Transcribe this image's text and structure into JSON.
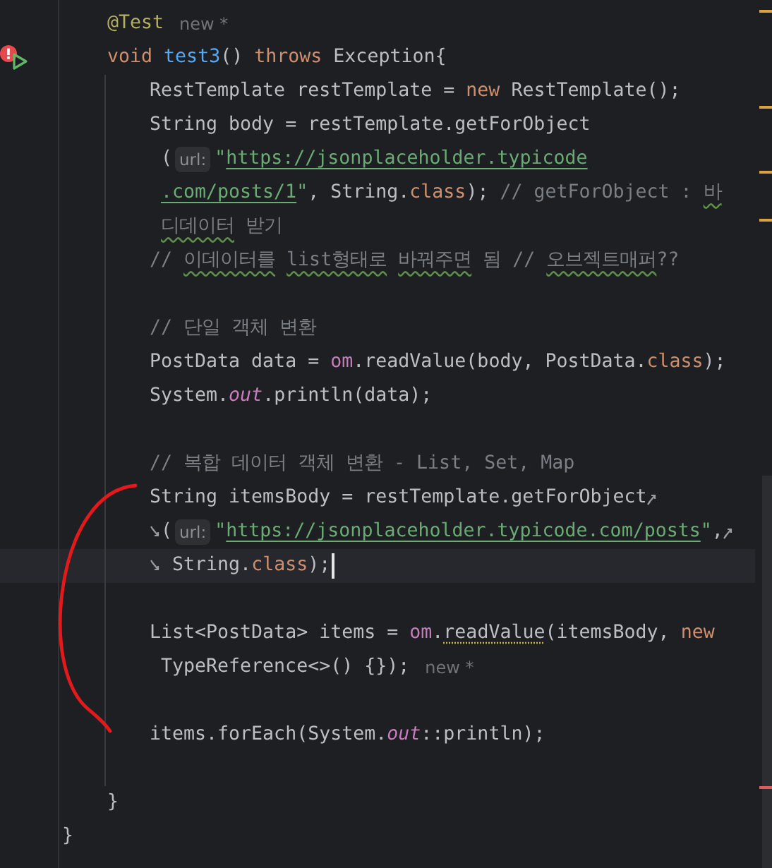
{
  "method": {
    "header": [
      {
        "tokens": [
          {
            "kind": "annotation",
            "text": "@Test"
          },
          {
            "kind": "hint",
            "text": "new *"
          }
        ]
      },
      {
        "error": true,
        "runnable": true,
        "tokens": [
          {
            "kind": "kw",
            "text": "void "
          },
          {
            "kind": "fn",
            "text": "test3"
          },
          {
            "kind": "plain",
            "text": "() "
          },
          {
            "kind": "kw",
            "text": "throws"
          },
          {
            "kind": "plain",
            "text": " Exception{"
          }
        ]
      }
    ],
    "body": [
      {
        "tokens": [
          {
            "kind": "plain",
            "text": "RestTemplate restTemplate = "
          },
          {
            "kind": "kw",
            "text": "new"
          },
          {
            "kind": "plain",
            "text": " RestTemplate();"
          }
        ]
      },
      {
        "tokens": [
          {
            "kind": "plain",
            "text": "String body = restTemplate.getForObject"
          }
        ]
      },
      {
        "continuation": true,
        "tokens": [
          {
            "kind": "plain",
            "text": "("
          },
          {
            "kind": "inlay",
            "text": "url:"
          },
          {
            "kind": "str",
            "text": "\""
          },
          {
            "kind": "url",
            "text": "https://jsonplaceholder.typicode"
          }
        ]
      },
      {
        "continuation": true,
        "tokens": [
          {
            "kind": "url",
            "text": ".com/posts/1"
          },
          {
            "kind": "str",
            "text": "\""
          },
          {
            "kind": "plain",
            "text": ", String."
          },
          {
            "kind": "kw",
            "text": "class"
          },
          {
            "kind": "plain",
            "text": "); "
          },
          {
            "kind": "comment",
            "text": "// getForObject : "
          },
          {
            "kind": "comment",
            "text": "바",
            "typo": true
          }
        ]
      },
      {
        "continuation": true,
        "tokens": [
          {
            "kind": "comment",
            "text": "디데이터",
            "typo": true
          },
          {
            "kind": "comment",
            "text": " 받기"
          }
        ]
      },
      {
        "tokens": [
          {
            "kind": "comment",
            "text": "// "
          },
          {
            "kind": "comment",
            "text": "이데이터를 ",
            "typo": true
          },
          {
            "kind": "comment",
            "text": "list형태로 ",
            "typo": true
          },
          {
            "kind": "comment",
            "text": "바꿔주면",
            "typo": true
          },
          {
            "kind": "comment",
            "text": " 됨 // "
          },
          {
            "kind": "comment",
            "text": "오브젝트매퍼",
            "typo": true
          },
          {
            "kind": "comment",
            "text": "??"
          }
        ]
      },
      {
        "blank_line_before": true,
        "tokens": [
          {
            "kind": "comment",
            "text": "// 단일 객체 변환"
          }
        ]
      },
      {
        "tokens": [
          {
            "kind": "plain",
            "text": "PostData data = "
          },
          {
            "kind": "field",
            "text": "om"
          },
          {
            "kind": "plain",
            "text": ".readValue(body, PostData."
          },
          {
            "kind": "kw",
            "text": "class"
          },
          {
            "kind": "plain",
            "text": ");"
          }
        ]
      },
      {
        "tokens": [
          {
            "kind": "plain",
            "text": "System."
          },
          {
            "kind": "static",
            "text": "out"
          },
          {
            "kind": "plain",
            "text": ".println(data);"
          }
        ]
      },
      {
        "blank_line_before": true,
        "tokens": [
          {
            "kind": "comment",
            "text": "// 복합 데이터 객체 변환 - List, Set, Map"
          }
        ]
      },
      {
        "tokens": [
          {
            "kind": "plain",
            "text": "String itemsBody = restTemplate.getForObject"
          },
          {
            "kind": "wrap-end"
          }
        ]
      },
      {
        "tokens": [
          {
            "kind": "wrap-start"
          },
          {
            "kind": "plain",
            "text": "("
          },
          {
            "kind": "inlay",
            "text": "url:"
          },
          {
            "kind": "str",
            "text": "\""
          },
          {
            "kind": "url",
            "text": "https://jsonplaceholder.typicode.com/posts"
          },
          {
            "kind": "str",
            "text": "\""
          },
          {
            "kind": "plain",
            "text": ","
          },
          {
            "kind": "wrap-end"
          }
        ]
      },
      {
        "current": true,
        "tokens": [
          {
            "kind": "wrap-start"
          },
          {
            "kind": "plain",
            "text": " String."
          },
          {
            "kind": "kw",
            "text": "class"
          },
          {
            "kind": "plain",
            "text": ");"
          }
        ]
      },
      {
        "blank_line_before": true,
        "tokens": [
          {
            "kind": "plain",
            "text": "List<PostData> items = "
          },
          {
            "kind": "field",
            "text": "om"
          },
          {
            "kind": "plain",
            "text": "."
          },
          {
            "kind": "plain",
            "text": "readValue",
            "weak": true
          },
          {
            "kind": "plain",
            "text": "(itemsBody, "
          },
          {
            "kind": "kw",
            "text": "new"
          }
        ]
      },
      {
        "continuation": true,
        "tokens": [
          {
            "kind": "plain",
            "text": "TypeReference<>() {});"
          },
          {
            "kind": "hint",
            "text": "new *"
          }
        ]
      },
      {
        "blank_line_before": true,
        "blank_line_after": true,
        "tokens": [
          {
            "kind": "plain",
            "text": "items.forEach(System."
          },
          {
            "kind": "static",
            "text": "out"
          },
          {
            "kind": "plain",
            "text": "::println);"
          }
        ]
      }
    ],
    "close": "}"
  },
  "class_close": "}"
}
